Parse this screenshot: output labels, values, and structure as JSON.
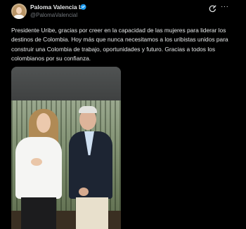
{
  "author": {
    "display_name": "Paloma Valencia L",
    "handle": "@PalomaValencial",
    "verified": true,
    "avatar_icon": "profile-photo"
  },
  "actions": {
    "grok_icon": "grok-icon",
    "more_label": "···"
  },
  "tweet": {
    "text": "Presidente Uribe, gracias por creer en la capacidad de las mujeres para liderar los destinos de Colombia. Hoy más que nunca necesitamos a los uribistas unidos para construir una Colombia de trabajo, oportunidades y futuro. Gracias a todos los colombianos por su confianza."
  },
  "colors": {
    "background": "#000000",
    "text_primary": "#e7e9ea",
    "text_secondary": "#71767b",
    "verified_blue": "#1d9bf0"
  }
}
